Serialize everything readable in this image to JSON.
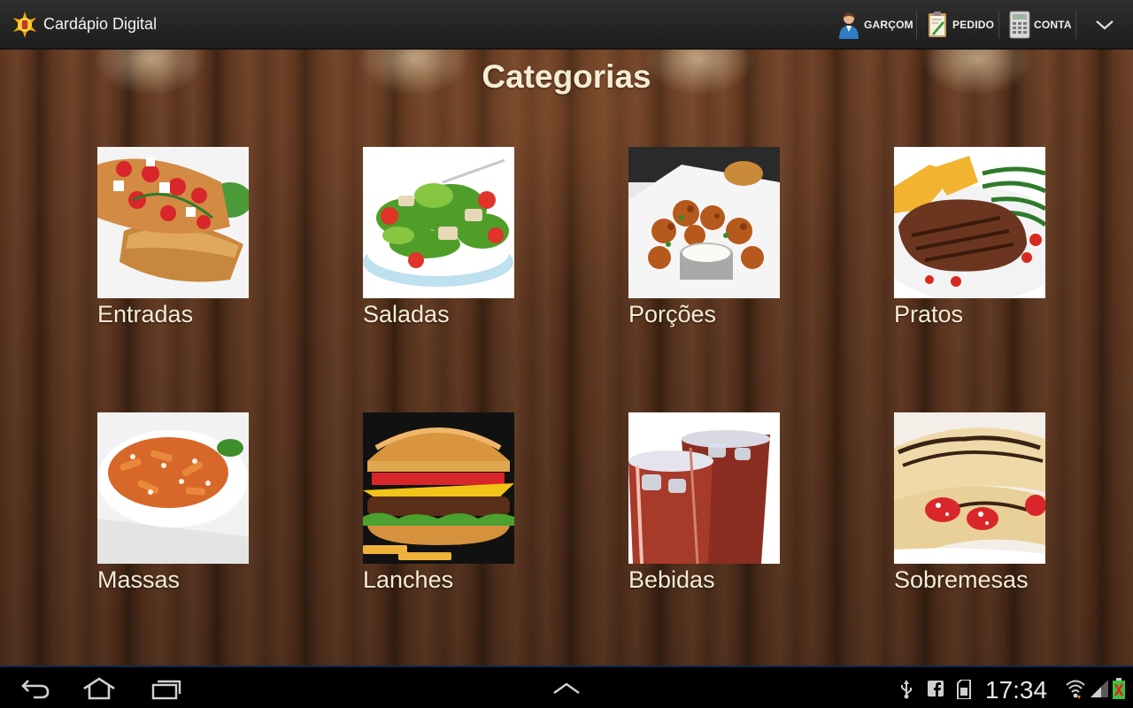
{
  "app": {
    "title": "Cardápio Digital",
    "logo_icon": "sun-star-logo-icon"
  },
  "actionbar": {
    "actions": [
      {
        "label": "GARÇOM",
        "icon": "waiter-person-icon"
      },
      {
        "label": "PEDIDO",
        "icon": "order-notepad-icon"
      },
      {
        "label": "CONTA",
        "icon": "calculator-icon"
      }
    ],
    "overflow_icon": "chevron-down-icon"
  },
  "main": {
    "title": "Categorias",
    "categories": [
      {
        "label": "Entradas",
        "icon": "bruschetta-photo"
      },
      {
        "label": "Saladas",
        "icon": "salad-photo"
      },
      {
        "label": "Porções",
        "icon": "fried-chicken-photo"
      },
      {
        "label": "Pratos",
        "icon": "steak-plate-photo"
      },
      {
        "label": "Massas",
        "icon": "pasta-photo"
      },
      {
        "label": "Lanches",
        "icon": "burger-photo"
      },
      {
        "label": "Bebidas",
        "icon": "cola-glasses-photo"
      },
      {
        "label": "Sobremesas",
        "icon": "crepe-photo"
      }
    ]
  },
  "systembar": {
    "clock": "17:34",
    "nav_icons": [
      "back-icon",
      "home-icon",
      "recent-apps-icon",
      "menu-up-icon"
    ],
    "status_icons": [
      "usb-icon",
      "facebook-icon",
      "sd-card-icon",
      "wifi-icon",
      "signal-icon",
      "battery-icon"
    ]
  },
  "colors": {
    "actionbar_bg": "#262626",
    "label_text": "#f6ecd5",
    "wood_dark": "#3f2414",
    "wood_light": "#704429"
  }
}
